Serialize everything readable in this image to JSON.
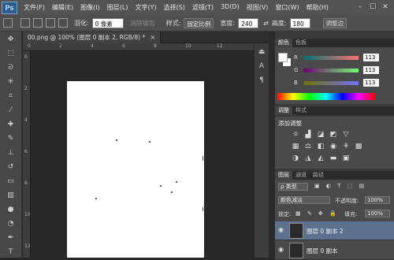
{
  "menubar": {
    "logo": "Ps",
    "items": [
      "文件(F)",
      "编辑(E)",
      "图像(I)",
      "图层(L)",
      "文字(Y)",
      "选择(S)",
      "滤镜(T)",
      "3D(D)",
      "视图(V)",
      "窗口(W)",
      "帮助(H)"
    ],
    "window_buttons": [
      "–",
      "☐",
      "✕"
    ]
  },
  "options": {
    "feather_label": "羽化:",
    "feather_value": "0 像素",
    "antialias_label": "消除锯齿",
    "style_label": "样式:",
    "style_value": "固定比例",
    "width_label": "宽度:",
    "width_value": "240",
    "height_label": "高度:",
    "height_value": "180",
    "refine_button": "调整边"
  },
  "document": {
    "tab_title": "00.png @ 100% (图层 0 副本 2, RGB/8) *",
    "tab_close": "×",
    "ruler_marks": [
      "0",
      "2",
      "4",
      "6",
      "8",
      "10",
      "12"
    ]
  },
  "color_panel": {
    "tabs": [
      "颜色",
      "色板"
    ],
    "channels": [
      {
        "label": "R",
        "value": "113"
      },
      {
        "label": "G",
        "value": "113"
      },
      {
        "label": "B",
        "value": "113"
      }
    ]
  },
  "adjust_panel": {
    "tabs": [
      "调整",
      "样式"
    ],
    "title": "添加调整"
  },
  "layers_panel": {
    "tabs": [
      "图层",
      "通道",
      "路径"
    ],
    "filter_label": "ρ 类型",
    "blend_mode": "颜色减淡",
    "opacity_label": "不透明度:",
    "opacity_value": "100%",
    "lock_label": "锁定:",
    "fill_label": "填充:",
    "fill_value": "100%",
    "layers": [
      {
        "name": "图层 0 副本 2",
        "selected": true
      },
      {
        "name": "图层 0 副本",
        "selected": false
      }
    ]
  }
}
